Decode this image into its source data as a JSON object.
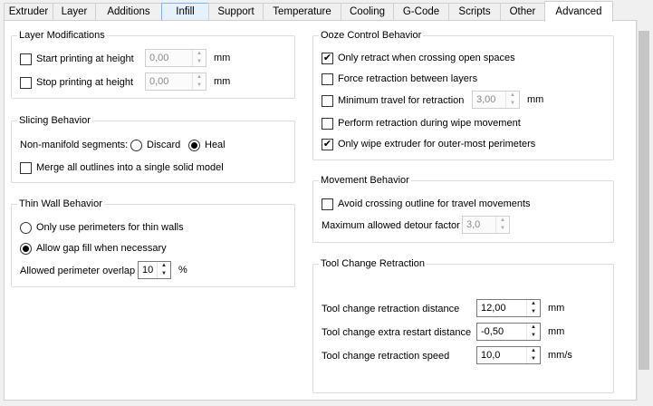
{
  "tabs": [
    "Extruder",
    "Layer",
    "Additions",
    "Infill",
    "Support",
    "Temperature",
    "Cooling",
    "G-Code",
    "Scripts",
    "Other",
    "Advanced"
  ],
  "layer_modifications": {
    "title": "Layer Modifications",
    "start_label": "Start printing at height",
    "start_value": "0,00",
    "start_unit": "mm",
    "start_checked": false,
    "stop_label": "Stop printing at height",
    "stop_value": "0,00",
    "stop_unit": "mm",
    "stop_checked": false
  },
  "slicing_behavior": {
    "title": "Slicing Behavior",
    "nonmanifold_label": "Non-manifold segments:",
    "discard_label": "Discard",
    "heal_label": "Heal",
    "selected": "Heal",
    "merge_label": "Merge all outlines into a single solid model",
    "merge_checked": false
  },
  "thin_wall": {
    "title": "Thin Wall Behavior",
    "only_perimeters_label": "Only use perimeters for thin walls",
    "gap_fill_label": "Allow gap fill when necessary",
    "selected": "Allow gap fill when necessary",
    "overlap_label": "Allowed perimeter overlap",
    "overlap_value": "10",
    "overlap_unit": "%"
  },
  "ooze_control": {
    "title": "Ooze Control Behavior",
    "only_retract_label": "Only retract when crossing open spaces",
    "only_retract_checked": true,
    "force_retract_label": "Force retraction between layers",
    "force_retract_checked": false,
    "min_travel_label": "Minimum travel for retraction",
    "min_travel_value": "3,00",
    "min_travel_unit": "mm",
    "min_travel_checked": false,
    "wipe_retract_label": "Perform retraction during wipe movement",
    "wipe_retract_checked": false,
    "only_wipe_label": "Only wipe extruder for outer-most perimeters",
    "only_wipe_checked": true
  },
  "movement": {
    "title": "Movement Behavior",
    "avoid_label": "Avoid crossing outline for travel movements",
    "avoid_checked": false,
    "detour_label": "Maximum allowed detour factor",
    "detour_value": "3,0"
  },
  "tool_change": {
    "title": "Tool Change Retraction",
    "distance_label": "Tool change retraction distance",
    "distance_value": "12,00",
    "distance_unit": "mm",
    "restart_label": "Tool change extra restart distance",
    "restart_value": "-0,50",
    "restart_unit": "mm",
    "speed_label": "Tool change retraction speed",
    "speed_value": "10,0",
    "speed_unit": "mm/s"
  },
  "glyphs": {
    "check": "✔",
    "up": "▲",
    "down": "▼"
  }
}
